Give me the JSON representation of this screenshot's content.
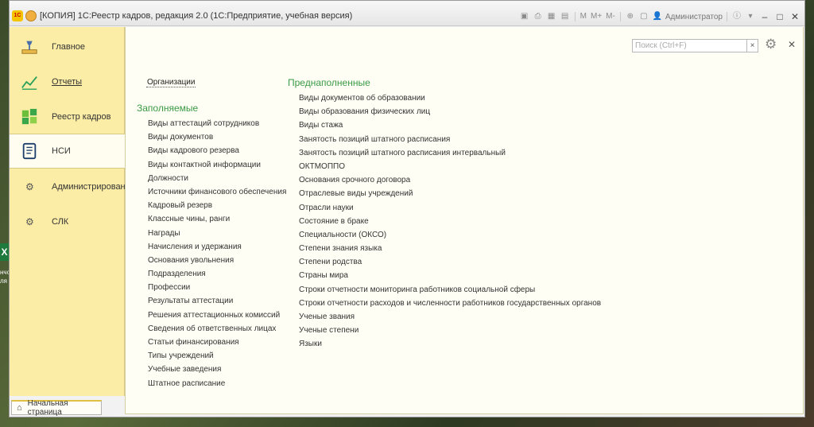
{
  "window": {
    "title": "[КОПИЯ] 1С:Реестр кадров, редакция 2.0  (1С:Предприятие, учебная версия)",
    "user": "Администратор",
    "toolbar_labels": [
      "M",
      "M+",
      "M-"
    ]
  },
  "desktop": {
    "excel_letter": "X",
    "text_1": "нчо",
    "text_2": "ля"
  },
  "sidebar": {
    "items": [
      {
        "label": "Главное",
        "icon": "desk-lamp-icon"
      },
      {
        "label": "Отчеты",
        "icon": "chart-icon"
      },
      {
        "label": "Реестр кадров",
        "icon": "squares-icon"
      },
      {
        "label": "НСИ",
        "icon": "book-icon"
      },
      {
        "label": "Администрирование",
        "icon": "gear-icon"
      },
      {
        "label": "СЛК",
        "icon": "gear-icon"
      }
    ]
  },
  "search": {
    "placeholder": "Поиск (Ctrl+F)",
    "clear": "×"
  },
  "org_link": "Организации",
  "sections": {
    "filled": {
      "title": "Заполняемые",
      "items": [
        "Виды аттестаций сотрудников",
        "Виды документов",
        "Виды кадрового резерва",
        "Виды контактной информации",
        "Должности",
        "Источники финансового обеспечения",
        "Кадровый резерв",
        "Классные чины, ранги",
        "Награды",
        "Начисления и удержания",
        "Основания увольнения",
        "Подразделения",
        "Профессии",
        "Результаты аттестации",
        "Решения аттестационных комиссий",
        "Сведения об ответственных лицах",
        "Статьи финансирования",
        "Типы учреждений",
        "Учебные заведения",
        "Штатное расписание"
      ]
    },
    "prefilled": {
      "title": "Преднаполненные",
      "items": [
        "Виды документов об образовании",
        "Виды образования физических лиц",
        "Виды стажа",
        "Занятость позиций штатного расписания",
        "Занятость позиций штатного расписания интервальный",
        "ОКТМОППО",
        "Основания срочного договора",
        "Отраслевые виды учреждений",
        "Отрасли науки",
        "Состояние в браке",
        "Специальности (ОКСО)",
        "Степени знания языка",
        "Степени родства",
        "Страны мира",
        "Строки отчетности мониторинга работников социальной сферы",
        "Строки отчетности расходов и численности работников государственных органов",
        "Ученые звания",
        "Ученые степени",
        "Языки"
      ]
    }
  },
  "bottom_tab": {
    "label": "Начальная страница"
  },
  "colors": {
    "sidebar": "#fbeda6",
    "section_title": "#3a9a45",
    "content_bg": "#fffef4"
  }
}
